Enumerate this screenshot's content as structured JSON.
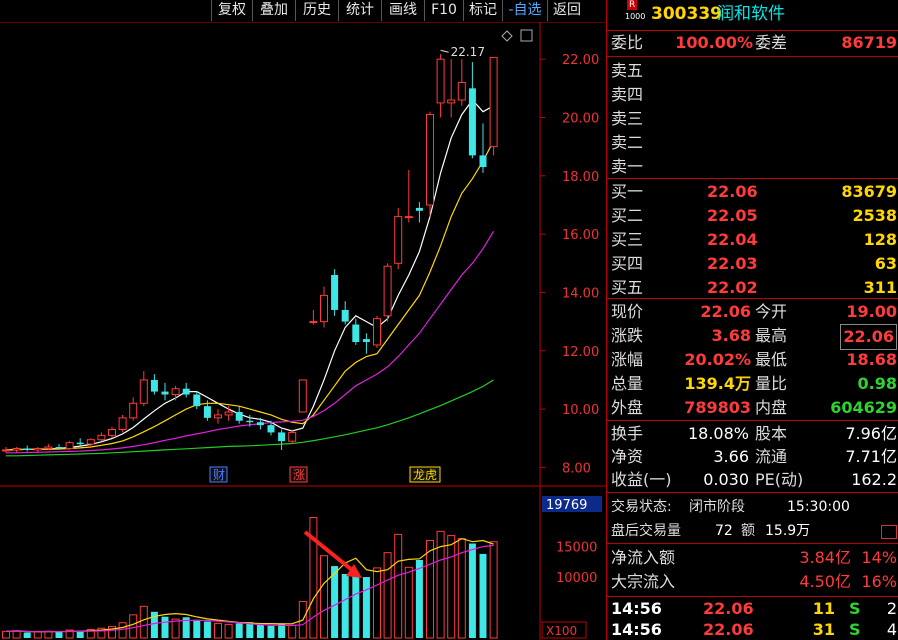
{
  "toolbar": {
    "items": [
      "复权",
      "叠加",
      "历史",
      "统计",
      "画线",
      "F10",
      "标记",
      "-自选",
      "返回"
    ]
  },
  "chart": {
    "price_ticks": [
      "22.00",
      "20.00",
      "18.00",
      "16.00",
      "14.00",
      "12.00",
      "10.00",
      "8.00"
    ],
    "high_label": "22.17",
    "event_labels": [
      "财",
      "涨",
      "龙虎"
    ],
    "vol_ticks": [
      "15000",
      "10000"
    ],
    "vol_current": "19769",
    "vol_unit": "X100"
  },
  "chart_data": {
    "type": "candlestick",
    "series_ohlc": [
      [
        8.6,
        8.7,
        8.5,
        8.6
      ],
      [
        8.6,
        8.7,
        8.5,
        8.65
      ],
      [
        8.65,
        8.75,
        8.55,
        8.6
      ],
      [
        8.6,
        8.7,
        8.5,
        8.65
      ],
      [
        8.65,
        8.8,
        8.6,
        8.7
      ],
      [
        8.7,
        8.8,
        8.6,
        8.65
      ],
      [
        8.65,
        8.9,
        8.6,
        8.85
      ],
      [
        8.85,
        9.0,
        8.75,
        8.8
      ],
      [
        8.8,
        9.0,
        8.7,
        8.95
      ],
      [
        8.95,
        9.2,
        8.9,
        9.1
      ],
      [
        9.1,
        9.4,
        9.0,
        9.3
      ],
      [
        9.3,
        9.8,
        9.2,
        9.7
      ],
      [
        9.7,
        10.4,
        9.6,
        10.2
      ],
      [
        10.2,
        11.3,
        10.1,
        11.0
      ],
      [
        11.0,
        11.2,
        10.5,
        10.6
      ],
      [
        10.6,
        10.9,
        10.3,
        10.5
      ],
      [
        10.5,
        10.8,
        10.3,
        10.7
      ],
      [
        10.7,
        10.9,
        10.4,
        10.5
      ],
      [
        10.5,
        10.6,
        10.0,
        10.1
      ],
      [
        10.1,
        10.3,
        9.6,
        9.7
      ],
      [
        9.7,
        10.0,
        9.5,
        9.8
      ],
      [
        9.8,
        10.1,
        9.6,
        9.9
      ],
      [
        9.9,
        10.1,
        9.5,
        9.6
      ],
      [
        9.6,
        9.8,
        9.4,
        9.55
      ],
      [
        9.55,
        9.7,
        9.3,
        9.45
      ],
      [
        9.45,
        9.6,
        9.1,
        9.2
      ],
      [
        9.2,
        9.3,
        8.6,
        8.9
      ],
      [
        8.9,
        9.3,
        8.8,
        9.2
      ],
      [
        9.9,
        11.0,
        9.9,
        11.0
      ],
      [
        13.0,
        13.4,
        12.9,
        13.0
      ],
      [
        13.0,
        14.2,
        12.8,
        13.9
      ],
      [
        14.6,
        14.8,
        13.2,
        13.4
      ],
      [
        13.4,
        13.7,
        12.9,
        13.0
      ],
      [
        12.9,
        13.1,
        12.2,
        12.3
      ],
      [
        12.4,
        12.6,
        11.9,
        12.3
      ],
      [
        12.2,
        13.2,
        12.1,
        13.1
      ],
      [
        13.2,
        15.0,
        13.0,
        14.9
      ],
      [
        15.0,
        16.9,
        14.8,
        16.6
      ],
      [
        16.6,
        18.2,
        16.4,
        16.6
      ],
      [
        16.9,
        17.1,
        16.4,
        16.8
      ],
      [
        17.0,
        20.2,
        16.6,
        20.1
      ],
      [
        20.5,
        22.17,
        20.0,
        22.0
      ],
      [
        20.5,
        22.0,
        20.0,
        20.6
      ],
      [
        20.6,
        22.0,
        20.4,
        21.2
      ],
      [
        21.0,
        21.9,
        18.6,
        18.7
      ],
      [
        18.7,
        19.8,
        18.1,
        18.3
      ],
      [
        19.0,
        22.06,
        18.7,
        22.06
      ]
    ],
    "price_range": [
      7.5,
      23.0
    ],
    "ma": [
      {
        "name": "MA5",
        "color": "#ffffff",
        "values": [
          8.6,
          8.62,
          8.62,
          8.62,
          8.64,
          8.65,
          8.69,
          8.73,
          8.79,
          8.88,
          8.99,
          9.15,
          9.37,
          9.66,
          9.94,
          10.2,
          10.38,
          10.6,
          10.6,
          10.4,
          10.2,
          10.0,
          9.83,
          9.7,
          9.65,
          9.55,
          9.35,
          9.25,
          9.35,
          10.1,
          11.0,
          12.0,
          12.8,
          13.2,
          13.0,
          12.8,
          13.1,
          13.9,
          14.6,
          15.4,
          16.6,
          18.1,
          19.3,
          20.1,
          20.6,
          20.2,
          20.4
        ]
      },
      {
        "name": "MA10",
        "color": "#ffd700",
        "values": [
          8.6,
          8.6,
          8.62,
          8.62,
          8.62,
          8.63,
          8.65,
          8.67,
          8.7,
          8.76,
          8.82,
          8.91,
          9.05,
          9.22,
          9.4,
          9.6,
          9.8,
          10.0,
          10.15,
          10.2,
          10.2,
          10.15,
          10.1,
          10.0,
          9.9,
          9.8,
          9.65,
          9.55,
          9.5,
          9.8,
          10.3,
          10.8,
          11.3,
          11.6,
          11.8,
          11.9,
          12.4,
          12.9,
          13.4,
          13.9,
          14.7,
          15.6,
          16.6,
          17.4,
          17.9,
          18.5,
          19.2
        ]
      },
      {
        "name": "MA20",
        "color": "#e020e0",
        "values": [
          8.5,
          8.5,
          8.51,
          8.52,
          8.53,
          8.54,
          8.55,
          8.56,
          8.58,
          8.6,
          8.63,
          8.67,
          8.72,
          8.78,
          8.85,
          8.93,
          9.0,
          9.08,
          9.15,
          9.22,
          9.3,
          9.36,
          9.42,
          9.46,
          9.5,
          9.54,
          9.56,
          9.58,
          9.62,
          9.75,
          9.95,
          10.2,
          10.5,
          10.8,
          11.0,
          11.2,
          11.45,
          11.8,
          12.2,
          12.6,
          13.1,
          13.6,
          14.1,
          14.6,
          15.0,
          15.5,
          16.1
        ]
      },
      {
        "name": "MA60",
        "color": "#22cc22",
        "values": [
          8.4,
          8.4,
          8.41,
          8.42,
          8.43,
          8.44,
          8.45,
          8.46,
          8.47,
          8.48,
          8.5,
          8.52,
          8.54,
          8.56,
          8.58,
          8.6,
          8.62,
          8.64,
          8.66,
          8.68,
          8.7,
          8.72,
          8.73,
          8.74,
          8.76,
          8.78,
          8.8,
          8.82,
          8.86,
          8.92,
          8.98,
          9.05,
          9.12,
          9.2,
          9.28,
          9.36,
          9.46,
          9.58,
          9.7,
          9.84,
          9.98,
          10.12,
          10.28,
          10.44,
          10.6,
          10.78,
          11.0
        ]
      }
    ],
    "volume": [
      1100,
      1200,
      900,
      1000,
      1100,
      1000,
      1300,
      1200,
      1400,
      1600,
      1900,
      2500,
      3800,
      5200,
      4300,
      3500,
      3100,
      3400,
      3000,
      2700,
      2400,
      2200,
      2400,
      2600,
      2200,
      2000,
      2400,
      2100,
      6000,
      19769,
      13500,
      11800,
      10500,
      10200,
      10000,
      11500,
      14000,
      17000,
      11600,
      12800,
      16000,
      17500,
      16800,
      16300,
      15500,
      13800,
      15800
    ],
    "vol_ma": [
      {
        "color": "#ffd700",
        "values": [
          1100,
          1150,
          1070,
          1050,
          1060,
          1040,
          1100,
          1120,
          1200,
          1300,
          1480,
          1720,
          2240,
          2980,
          3540,
          3860,
          4000,
          3860,
          3460,
          3140,
          2940,
          2740,
          2540,
          2460,
          2360,
          2360,
          2320,
          2340,
          2940,
          6450,
          8970,
          10600,
          12300,
          13100,
          11200,
          10900,
          11200,
          12600,
          12900,
          13000,
          14300,
          15000,
          15300,
          16300,
          15800,
          16000,
          15400
        ]
      },
      {
        "color": "#e020e0",
        "values": [
          1100,
          1130,
          1060,
          1040,
          1050,
          1030,
          1070,
          1080,
          1110,
          1160,
          1260,
          1420,
          1690,
          2050,
          2380,
          2600,
          2770,
          2880,
          2900,
          2870,
          2760,
          2620,
          2470,
          2330,
          2200,
          2120,
          2090,
          2050,
          2180,
          3440,
          4530,
          5380,
          6300,
          7200,
          7900,
          8700,
          9500,
          10300,
          10800,
          11400,
          12100,
          12800,
          13300,
          14000,
          14500,
          15000,
          15200
        ]
      }
    ],
    "vol_range": [
      0,
      21000
    ]
  },
  "quote": {
    "code": "300339",
    "name": "润和软件",
    "badge_top": "R",
    "badge_bot": "1000",
    "weibi_label": "委比",
    "weibi": "100.00%",
    "weicha_label": "委差",
    "weicha": "86719",
    "sell": [
      {
        "label": "卖五",
        "price": "",
        "vol": ""
      },
      {
        "label": "卖四",
        "price": "",
        "vol": ""
      },
      {
        "label": "卖三",
        "price": "",
        "vol": ""
      },
      {
        "label": "卖二",
        "price": "",
        "vol": ""
      },
      {
        "label": "卖一",
        "price": "",
        "vol": ""
      }
    ],
    "buy": [
      {
        "label": "买一",
        "price": "22.06",
        "vol": "83679"
      },
      {
        "label": "买二",
        "price": "22.05",
        "vol": "2538"
      },
      {
        "label": "买三",
        "price": "22.04",
        "vol": "128"
      },
      {
        "label": "买四",
        "price": "22.03",
        "vol": "63"
      },
      {
        "label": "买五",
        "price": "22.02",
        "vol": "311"
      }
    ],
    "stats": [
      {
        "l1": "现价",
        "v1": "22.06",
        "c1": "red",
        "l2": "今开",
        "v2": "19.00",
        "c2": "red"
      },
      {
        "l1": "涨跌",
        "v1": "3.68",
        "c1": "red",
        "l2": "最高",
        "v2": "22.06",
        "c2": "red"
      },
      {
        "l1": "涨幅",
        "v1": "20.02%",
        "c1": "red",
        "l2": "最低",
        "v2": "18.68",
        "c2": "red"
      },
      {
        "l1": "总量",
        "v1": "139.4万",
        "c1": "yel",
        "l2": "量比",
        "v2": "0.98",
        "c2": "grn"
      },
      {
        "l1": "外盘",
        "v1": "789803",
        "c1": "red",
        "l2": "内盘",
        "v2": "604629",
        "c2": "grn"
      }
    ],
    "fund": [
      {
        "l1": "换手",
        "v1": "18.08%",
        "l2": "股本",
        "v2": "7.96亿"
      },
      {
        "l1": "净资",
        "v1": "3.66",
        "l2": "流通",
        "v2": "7.71亿"
      },
      {
        "l1": "收益(一)",
        "v1": "0.030",
        "l2": "PE(动)",
        "v2": "162.2"
      }
    ],
    "status_label": "交易状态:",
    "status_value": "闭市阶段",
    "status_time": "15:30:00",
    "after_label": "盘后交易量",
    "after_vol": "72",
    "after_amt_label": "额",
    "after_amt": "15.9万",
    "inflow_label": "净流入额",
    "inflow": "3.84亿",
    "inflow_pct": "14%",
    "block_label": "大宗流入",
    "block": "4.50亿",
    "block_pct": "16%",
    "ticks": [
      {
        "time": "14:56",
        "price": "22.06",
        "vol": "11",
        "side": "S",
        "n": "2"
      },
      {
        "time": "14:56",
        "price": "22.06",
        "vol": "31",
        "side": "S",
        "n": "4"
      }
    ],
    "colors": {
      "up": "#ff3b3b",
      "down": "#2dd42d",
      "accent": "#ffd700",
      "border": "#bb0000"
    }
  }
}
